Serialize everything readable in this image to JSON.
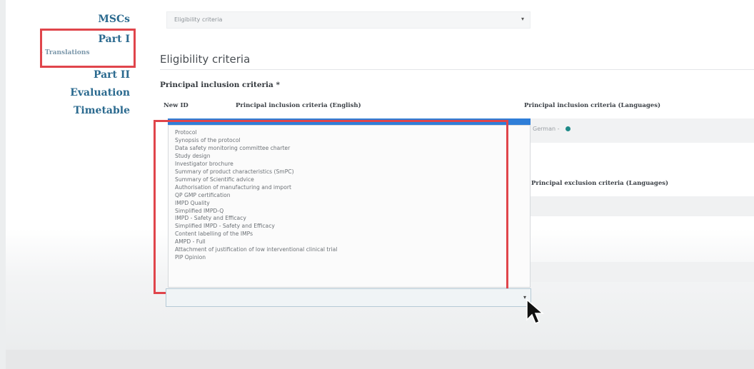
{
  "nav": {
    "mscs": "MSCs",
    "part1": "Part I",
    "translations": "- Translations",
    "part2": "Part II",
    "evaluation": "Evaluation",
    "timetable": "Timetable"
  },
  "top_select": {
    "value": "Eligibility criteria"
  },
  "section_title": "Eligibility criteria",
  "principal_inclusion": {
    "heading": "Principal inclusion criteria *",
    "col_new_id": "New ID",
    "col_english": "Principal inclusion criteria (English)",
    "col_languages": "Principal inclusion criteria (Languages)",
    "language_value": "German -"
  },
  "principal_exclusion": {
    "col_languages": "Principal exclusion criteria (Languages)"
  },
  "dropdown_options": [
    "Protocol",
    "Synopsis of the protocol",
    "Data safety monitoring committee charter",
    "Study design",
    "Investigator brochure",
    "Summary of product characteristics (SmPC)",
    "Summary of Scientific advice",
    "Authorisation of manufacturing and import",
    "QP GMP certification",
    "IMPD Quality",
    "Simplified IMPD-Q",
    "IMPD - Safety and Efficacy",
    "Simplified IMPD - Safety and Efficacy",
    "Content labelling of the IMPs",
    "AMPD - Full",
    "Attachment of justification of low interventional clinical trial",
    "PIP Opinion"
  ],
  "colors": {
    "nav": "#2b6a8f",
    "highlight": "#e0454b",
    "selected_bar": "#2f7ed8"
  },
  "icons": [
    "chevron-down-icon",
    "globe-icon",
    "mouse-pointer-icon"
  ]
}
